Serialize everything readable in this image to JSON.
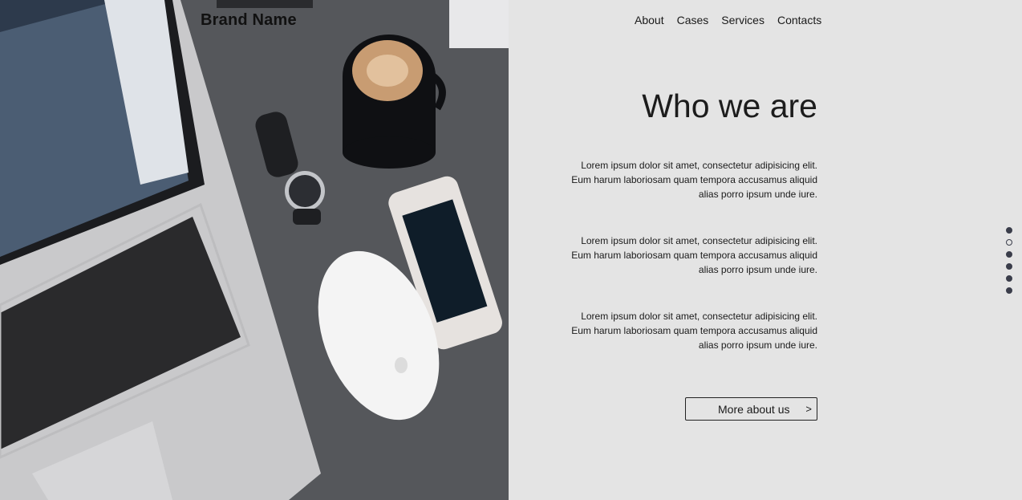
{
  "brand": {
    "name": "Brand Name"
  },
  "nav": {
    "items": [
      "About",
      "Cases",
      "Services",
      "Contacts"
    ]
  },
  "hero": {
    "title": "Who we are",
    "paragraphs": [
      "Lorem ipsum dolor sit amet, consectetur adipisicing elit. Eum harum laboriosam quam tempora accusamus aliquid alias porro ipsum unde iure.",
      "Lorem ipsum dolor sit amet, consectetur adipisicing elit. Eum harum laboriosam quam tempora accusamus aliquid alias porro ipsum unde iure.",
      "Lorem ipsum dolor sit amet, consectetur adipisicing elit. Eum harum laboriosam quam tempora accusamus aliquid alias porro ipsum unde iure."
    ],
    "button_label": "More about us",
    "button_arrow": ">"
  },
  "pagination": {
    "count": 6,
    "active_index": 1
  },
  "colors": {
    "background": "#e4e4e4",
    "dot": "#3a3d4a",
    "text": "#1c1c1c"
  },
  "icons": {
    "photo": "desk-workspace-photo"
  }
}
